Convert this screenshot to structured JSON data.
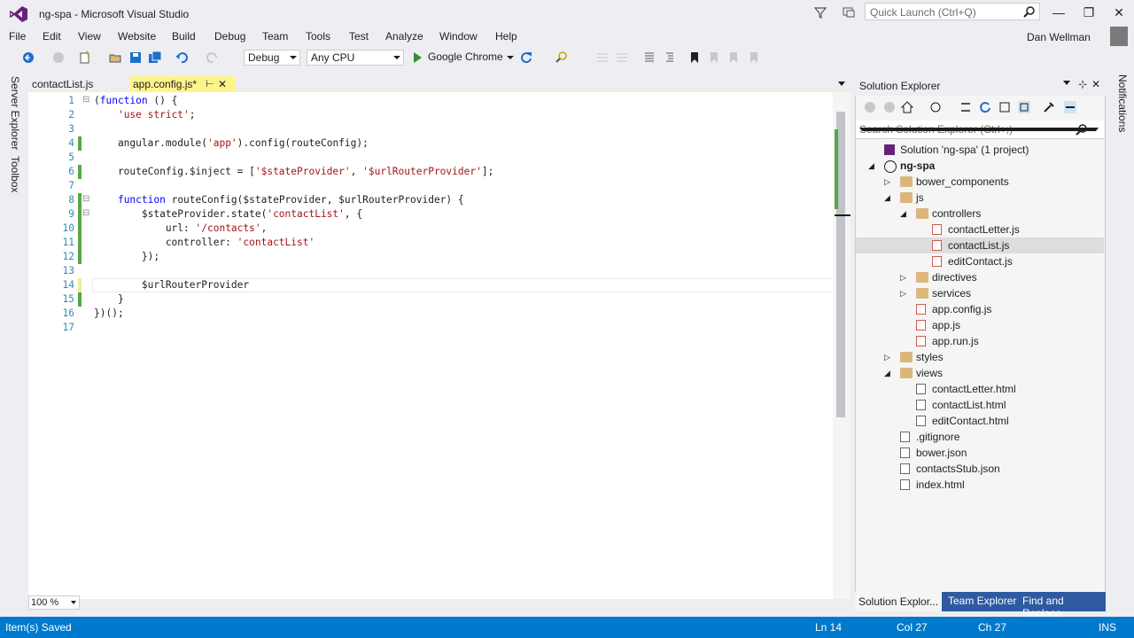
{
  "title_bar": {
    "window_title": "ng-spa - Microsoft Visual Studio",
    "quick_launch_placeholder": "Quick Launch (Ctrl+Q)"
  },
  "menu": {
    "items": [
      "File",
      "Edit",
      "View",
      "Website",
      "Build",
      "Debug",
      "Team",
      "Tools",
      "Test",
      "Analyze",
      "Window",
      "Help"
    ],
    "user": "Dan Wellman"
  },
  "toolbar": {
    "config": "Debug",
    "platform": "Any CPU",
    "run_target": "Google Chrome"
  },
  "side_tabs": {
    "server_explorer": "Server Explorer",
    "toolbox": "Toolbox",
    "notifications": "Notifications"
  },
  "editor": {
    "tabs": [
      "contactList.js",
      "app.config.js*"
    ],
    "zoom": "100 %",
    "lines": [
      {
        "n": "1",
        "text": "(function () {"
      },
      {
        "n": "2",
        "text": "    'use strict';"
      },
      {
        "n": "3",
        "text": ""
      },
      {
        "n": "4",
        "text": "    angular.module('app').config(routeConfig);"
      },
      {
        "n": "5",
        "text": ""
      },
      {
        "n": "6",
        "text": "    routeConfig.$inject = ['$stateProvider', '$urlRouterProvider'];"
      },
      {
        "n": "7",
        "text": ""
      },
      {
        "n": "8",
        "text": "    function routeConfig($stateProvider, $urlRouterProvider) {"
      },
      {
        "n": "9",
        "text": "        $stateProvider.state('contactList', {"
      },
      {
        "n": "10",
        "text": "            url: '/contacts',"
      },
      {
        "n": "11",
        "text": "            controller: 'contactList'"
      },
      {
        "n": "12",
        "text": "        });"
      },
      {
        "n": "13",
        "text": ""
      },
      {
        "n": "14",
        "text": "        $urlRouterProvider"
      },
      {
        "n": "15",
        "text": "    }"
      },
      {
        "n": "16",
        "text": "})();"
      },
      {
        "n": "17",
        "text": ""
      }
    ]
  },
  "solution_explorer": {
    "title": "Solution Explorer",
    "search_placeholder": "Search Solution Explorer (Ctrl+;)",
    "tree": [
      {
        "label": "Solution 'ng-spa' (1 project)",
        "depth": 0,
        "type": "solution",
        "toggle": ""
      },
      {
        "label": "ng-spa",
        "depth": 0,
        "type": "project",
        "toggle": "open"
      },
      {
        "label": "bower_components",
        "depth": 1,
        "type": "folder",
        "toggle": "closed"
      },
      {
        "label": "js",
        "depth": 1,
        "type": "folder",
        "toggle": "open"
      },
      {
        "label": "controllers",
        "depth": 2,
        "type": "folder",
        "toggle": "open"
      },
      {
        "label": "contactLetter.js",
        "depth": 3,
        "type": "js",
        "toggle": ""
      },
      {
        "label": "contactList.js",
        "depth": 3,
        "type": "js",
        "toggle": "",
        "selected": true
      },
      {
        "label": "editContact.js",
        "depth": 3,
        "type": "js",
        "toggle": ""
      },
      {
        "label": "directives",
        "depth": 2,
        "type": "folder",
        "toggle": "closed"
      },
      {
        "label": "services",
        "depth": 2,
        "type": "folder",
        "toggle": "closed"
      },
      {
        "label": "app.config.js",
        "depth": 2,
        "type": "js",
        "toggle": ""
      },
      {
        "label": "app.js",
        "depth": 2,
        "type": "js",
        "toggle": ""
      },
      {
        "label": "app.run.js",
        "depth": 2,
        "type": "js",
        "toggle": ""
      },
      {
        "label": "styles",
        "depth": 1,
        "type": "folder",
        "toggle": "closed"
      },
      {
        "label": "views",
        "depth": 1,
        "type": "folder",
        "toggle": "open"
      },
      {
        "label": "contactLetter.html",
        "depth": 2,
        "type": "html",
        "toggle": ""
      },
      {
        "label": "contactList.html",
        "depth": 2,
        "type": "html",
        "toggle": ""
      },
      {
        "label": "editContact.html",
        "depth": 2,
        "type": "html",
        "toggle": ""
      },
      {
        "label": ".gitignore",
        "depth": 1,
        "type": "file",
        "toggle": ""
      },
      {
        "label": "bower.json",
        "depth": 1,
        "type": "file",
        "toggle": ""
      },
      {
        "label": "contactsStub.json",
        "depth": 1,
        "type": "file",
        "toggle": ""
      },
      {
        "label": "index.html",
        "depth": 1,
        "type": "html",
        "toggle": ""
      }
    ],
    "bottom_tabs": [
      "Solution Explor...",
      "Team Explorer",
      "Find and Replace"
    ]
  },
  "status_bar": {
    "message": "Item(s) Saved",
    "line": "Ln 14",
    "col": "Col 27",
    "ch": "Ch 27",
    "mode": "INS"
  },
  "colors": {
    "status_bar": "#007acc",
    "tab_active": "#fff48c",
    "keyword": "#0000ff",
    "string": "#a31515",
    "line_number": "#2b91af"
  }
}
